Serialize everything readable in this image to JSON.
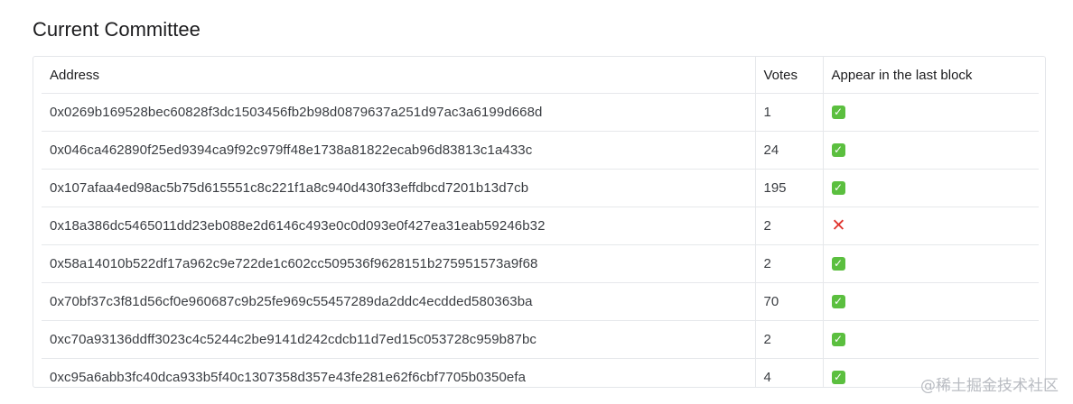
{
  "section": {
    "title": "Current Committee"
  },
  "table": {
    "columns": {
      "address": "Address",
      "votes": "Votes",
      "last_block": "Appear in the last block"
    },
    "rows": [
      {
        "address": "0x0269b169528bec60828f3dc1503456fb2b98d0879637a251d97ac3a6199d668d",
        "votes": "1",
        "in_last_block": true,
        "status_icon": "check-mark-icon"
      },
      {
        "address": "0x046ca462890f25ed9394ca9f92c979ff48e1738a81822ecab96d83813c1a433c",
        "votes": "24",
        "in_last_block": true,
        "status_icon": "check-mark-icon"
      },
      {
        "address": "0x107afaa4ed98ac5b75d615551c8c221f1a8c940d430f33effdbcd7201b13d7cb",
        "votes": "195",
        "in_last_block": true,
        "status_icon": "check-mark-icon"
      },
      {
        "address": "0x18a386dc5465011dd23eb088e2d6146c493e0c0d093e0f427ea31eab59246b32",
        "votes": "2",
        "in_last_block": false,
        "status_icon": "cross-mark-icon"
      },
      {
        "address": "0x58a14010b522df17a962c9e722de1c602cc509536f9628151b275951573a9f68",
        "votes": "2",
        "in_last_block": true,
        "status_icon": "check-mark-icon"
      },
      {
        "address": "0x70bf37c3f81d56cf0e960687c9b25fe969c55457289da2ddc4ecdded580363ba",
        "votes": "70",
        "in_last_block": true,
        "status_icon": "check-mark-icon"
      },
      {
        "address": "0xc70a93136ddff3023c4c5244c2be9141d242cdcb11d7ed15c053728c959b87bc",
        "votes": "2",
        "in_last_block": true,
        "status_icon": "check-mark-icon"
      },
      {
        "address": "0xc95a6abb3fc40dca933b5f40c1307358d357e43fe281e62f6cbf7705b0350efa",
        "votes": "4",
        "in_last_block": true,
        "status_icon": "check-mark-icon"
      }
    ]
  },
  "icons": {
    "check_glyph": "✓",
    "cross_glyph": "✕"
  },
  "colors": {
    "check_green": "#5bbf3f",
    "cross_red": "#e0352f"
  },
  "watermark": {
    "text": "@稀土掘金技术社区"
  }
}
